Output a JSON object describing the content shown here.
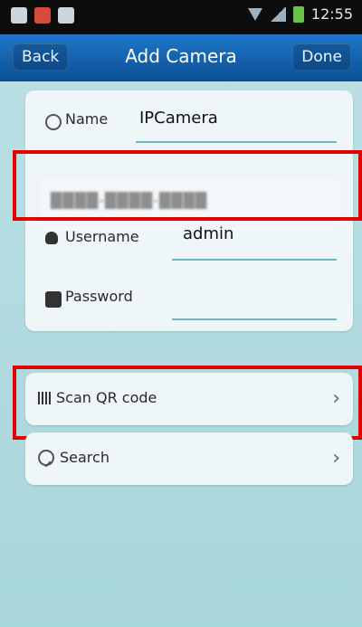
{
  "status_bar": {
    "time": "12:55",
    "icons": [
      "app-icon",
      "notification-icon",
      "game-icon",
      "wifi-icon",
      "signal-icon",
      "battery-icon"
    ]
  },
  "header": {
    "back_label": "Back",
    "title": "Add Camera",
    "done_label": "Done"
  },
  "form": {
    "name_label": "Name",
    "name_value": "IPCamera",
    "obscured_value": "████-████-████",
    "username_label": "Username",
    "username_value": "admin",
    "password_label": "Password",
    "password_value": ""
  },
  "actions": {
    "scan_label": "Scan QR code",
    "search_label": "Search"
  },
  "colors": {
    "header_blue": "#1f77c8",
    "highlight_red": "#e10000",
    "background_teal": "#b9dfe4",
    "underline_blue": "#6bb7c9"
  }
}
